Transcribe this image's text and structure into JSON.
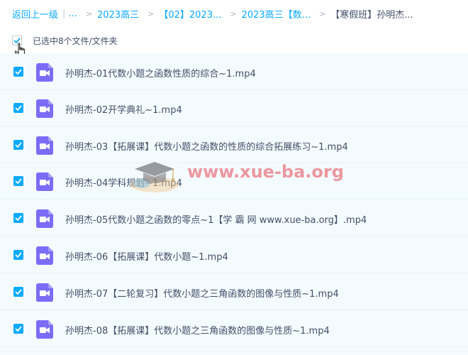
{
  "breadcrumb": {
    "back_label": "返回上一级",
    "separator": "|",
    "ellipsis": "...",
    "items": [
      "2023高三",
      "【02】2023...",
      "2023高三【数...",
      "【寒假班】孙明杰..."
    ]
  },
  "selection": {
    "status_text": "已选中8个文件/文件夹"
  },
  "files": [
    {
      "name": "孙明杰-01代数小题之函数性质的综合~1.mp4",
      "checked": true,
      "icon": "video-file-icon"
    },
    {
      "name": "孙明杰-02开学典礼~1.mp4",
      "checked": true,
      "icon": "video-file-icon"
    },
    {
      "name": "孙明杰-03【拓展课】代数小题之函数的性质的综合拓展练习~1.mp4",
      "checked": true,
      "icon": "video-file-icon"
    },
    {
      "name": "孙明杰-04学科规划~1.mp4",
      "checked": true,
      "icon": "video-file-icon"
    },
    {
      "name": "孙明杰-05代数小题之函数的零点~1【学 霸 网 www.xue-ba.org】.mp4",
      "checked": true,
      "icon": "video-file-icon"
    },
    {
      "name": "孙明杰-06【拓展课】代数小题~1.mp4",
      "checked": true,
      "icon": "video-file-icon"
    },
    {
      "name": "孙明杰-07【二轮复习】代数小题之三角函数的图像与性质~1.mp4",
      "checked": true,
      "icon": "video-file-icon"
    },
    {
      "name": "孙明杰-08【拓展课】代数小题之三角函数的图像与性质~1.mp4",
      "checked": true,
      "icon": "video-file-icon"
    }
  ],
  "watermark": {
    "text": "www.xue-ba.org"
  },
  "colors": {
    "accent": "#09aaff",
    "video_icon": "#7b6cf6",
    "list_background": "#f4fbff",
    "text": "#424e67"
  }
}
